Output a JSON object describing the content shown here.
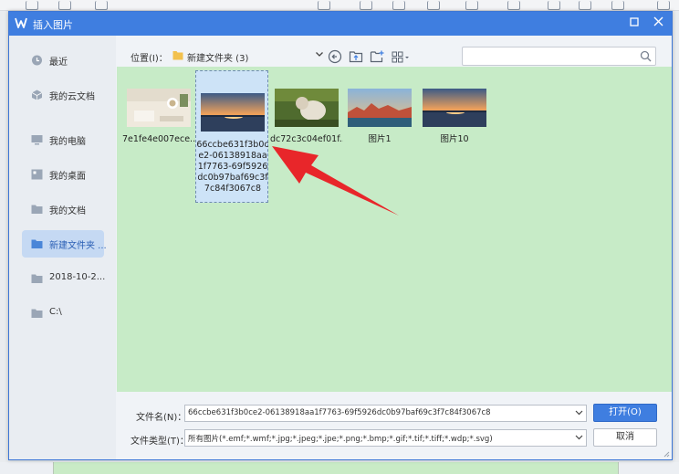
{
  "dialog": {
    "title": "插入图片",
    "maximize_icon": "maximize-icon",
    "close_icon": "close-icon"
  },
  "sidebar": {
    "items": [
      {
        "label": "最近",
        "icon": "clock-icon"
      },
      {
        "label": "我的云文档",
        "icon": "cloud-cube-icon"
      },
      {
        "label": "我的电脑",
        "icon": "computer-icon"
      },
      {
        "label": "我的桌面",
        "icon": "desktop-icon"
      },
      {
        "label": "我的文档",
        "icon": "folder-icon"
      },
      {
        "label": "新建文件夹 ...",
        "icon": "folder-icon",
        "active": true
      },
      {
        "label": "2018-10-2...",
        "icon": "folder-icon"
      },
      {
        "label": "C:\\",
        "icon": "folder-icon"
      }
    ]
  },
  "toolbar": {
    "location_label": "位置(I)：",
    "current_path": "新建文件夹 (3)",
    "icons": [
      "back-icon",
      "up-folder-icon",
      "new-folder-icon",
      "view-mode-icon"
    ],
    "search_placeholder": ""
  },
  "files": [
    {
      "name": "7e1fe4e007ece...",
      "thumb": "desk-photo"
    },
    {
      "name": "66ccbe631f3b0ce2-06138918aa1f7763-69f5926dc0b97baf69c3f7c84f3067c8",
      "thumb": "sunset-lake",
      "selected": true
    },
    {
      "name": "dc72c3c04ef01f...",
      "thumb": "cat-photo"
    },
    {
      "name": "图片1",
      "thumb": "city-sunset"
    },
    {
      "name": "图片10",
      "thumb": "sunset-lake"
    }
  ],
  "form": {
    "filename_label": "文件名(N)：",
    "filename_value": "66ccbe631f3b0ce2-06138918aa1f7763-69f5926dc0b97baf69c3f7c84f3067c8",
    "filetype_label": "文件类型(T)：",
    "filetype_value": "所有图片(*.emf;*.wmf;*.jpg;*.jpeg;*.jpe;*.png;*.bmp;*.gif;*.tif;*.tiff;*.wdp;*.svg)",
    "open_label": "打开(O)",
    "cancel_label": "取消"
  },
  "colors": {
    "accent": "#3f7ee0",
    "file_area": "#c7ebc7",
    "annotation_arrow": "#e8262a"
  }
}
